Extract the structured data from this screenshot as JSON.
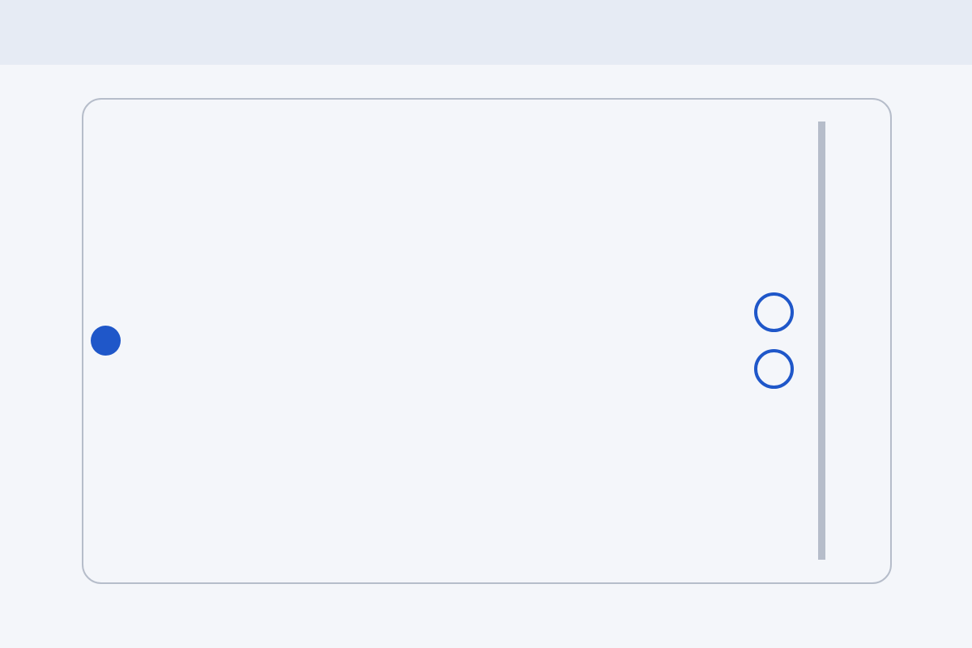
{
  "colors": {
    "top_bar": "#e6ebf4",
    "background": "#f4f6fa",
    "frame_border": "#b6bdca",
    "node_accent": "#1f57c9",
    "scrollbar": "#b6bdca"
  },
  "canvas": {
    "nodes": [
      {
        "kind": "filled",
        "icon": "filled-circle-dot"
      },
      {
        "kind": "hollow",
        "icon": "hollow-circle-port"
      },
      {
        "kind": "hollow",
        "icon": "hollow-circle-port"
      }
    ]
  }
}
